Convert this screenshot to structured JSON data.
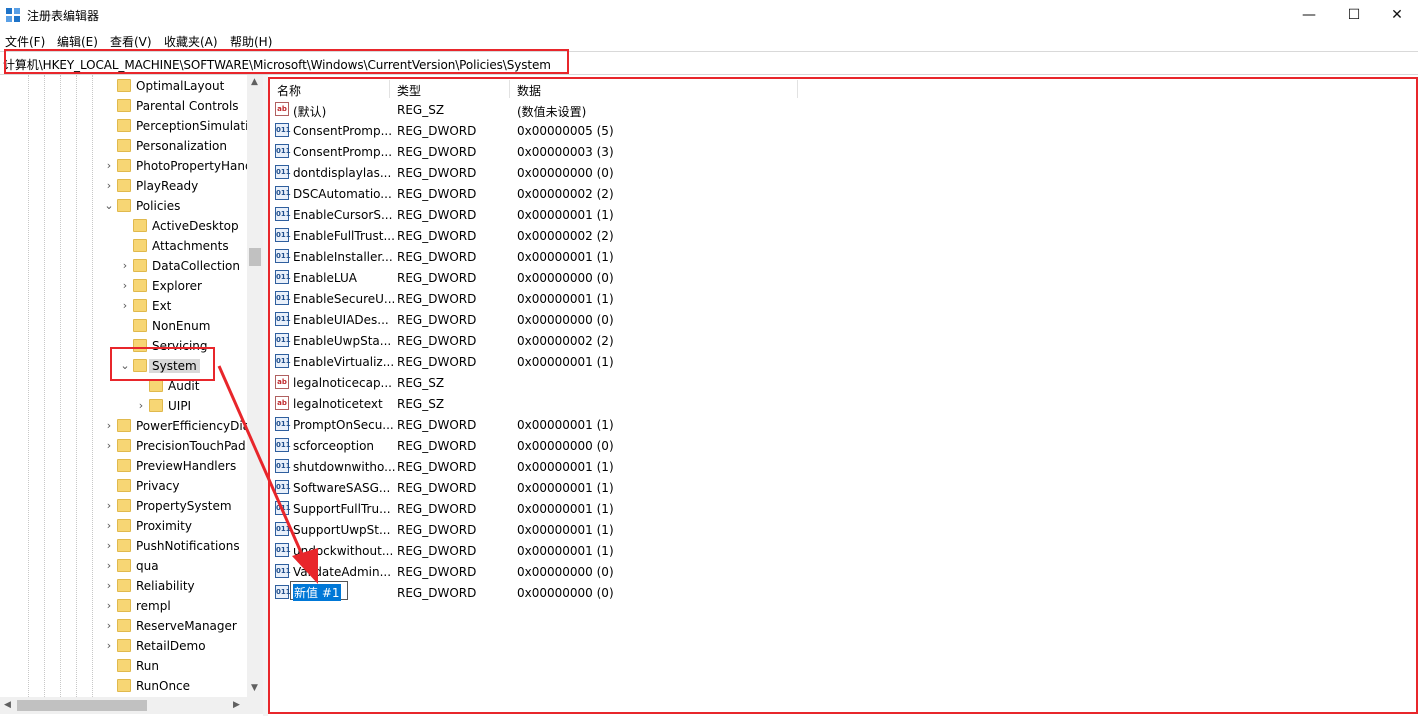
{
  "window": {
    "title": "注册表编辑器",
    "minimize_glyph": "—",
    "maximize_glyph": "☐",
    "close_glyph": "✕"
  },
  "menu": [
    "文件(F)",
    "编辑(E)",
    "查看(V)",
    "收藏夹(A)",
    "帮助(H)"
  ],
  "address": "计算机\\HKEY_LOCAL_MACHINE\\SOFTWARE\\Microsoft\\Windows\\CurrentVersion\\Policies\\System",
  "tree": [
    {
      "label": "OptimalLayout",
      "depth": 0,
      "chevron": ""
    },
    {
      "label": "Parental Controls",
      "depth": 0,
      "chevron": ""
    },
    {
      "label": "PerceptionSimulation",
      "depth": 0,
      "chevron": ""
    },
    {
      "label": "Personalization",
      "depth": 0,
      "chevron": ""
    },
    {
      "label": "PhotoPropertyHandler",
      "depth": 0,
      "chevron": "›"
    },
    {
      "label": "PlayReady",
      "depth": 0,
      "chevron": "›"
    },
    {
      "label": "Policies",
      "depth": 0,
      "chevron": "⌄"
    },
    {
      "label": "ActiveDesktop",
      "depth": 1,
      "chevron": ""
    },
    {
      "label": "Attachments",
      "depth": 1,
      "chevron": ""
    },
    {
      "label": "DataCollection",
      "depth": 1,
      "chevron": "›"
    },
    {
      "label": "Explorer",
      "depth": 1,
      "chevron": "›"
    },
    {
      "label": "Ext",
      "depth": 1,
      "chevron": "›"
    },
    {
      "label": "NonEnum",
      "depth": 1,
      "chevron": ""
    },
    {
      "label": "Servicing",
      "depth": 1,
      "chevron": ""
    },
    {
      "label": "System",
      "depth": 1,
      "chevron": "⌄",
      "selected": true
    },
    {
      "label": "Audit",
      "depth": 2,
      "chevron": ""
    },
    {
      "label": "UIPI",
      "depth": 2,
      "chevron": "›"
    },
    {
      "label": "PowerEfficiencyDiagnostics",
      "depth": 0,
      "chevron": "›"
    },
    {
      "label": "PrecisionTouchPad",
      "depth": 0,
      "chevron": "›"
    },
    {
      "label": "PreviewHandlers",
      "depth": 0,
      "chevron": ""
    },
    {
      "label": "Privacy",
      "depth": 0,
      "chevron": ""
    },
    {
      "label": "PropertySystem",
      "depth": 0,
      "chevron": "›"
    },
    {
      "label": "Proximity",
      "depth": 0,
      "chevron": "›"
    },
    {
      "label": "PushNotifications",
      "depth": 0,
      "chevron": "›"
    },
    {
      "label": "qua",
      "depth": 0,
      "chevron": "›"
    },
    {
      "label": "Reliability",
      "depth": 0,
      "chevron": "›"
    },
    {
      "label": "rempl",
      "depth": 0,
      "chevron": "›"
    },
    {
      "label": "ReserveManager",
      "depth": 0,
      "chevron": "›"
    },
    {
      "label": "RetailDemo",
      "depth": 0,
      "chevron": "›"
    },
    {
      "label": "Run",
      "depth": 0,
      "chevron": ""
    },
    {
      "label": "RunOnce",
      "depth": 0,
      "chevron": ""
    }
  ],
  "list": {
    "headers": [
      "名称",
      "类型",
      "数据"
    ],
    "rows": [
      {
        "icon": "sz",
        "name": "(默认)",
        "type": "REG_SZ",
        "data": "(数值未设置)"
      },
      {
        "icon": "dw",
        "name": "ConsentPromp...",
        "type": "REG_DWORD",
        "data": "0x00000005 (5)"
      },
      {
        "icon": "dw",
        "name": "ConsentPromp...",
        "type": "REG_DWORD",
        "data": "0x00000003 (3)"
      },
      {
        "icon": "dw",
        "name": "dontdisplaylas...",
        "type": "REG_DWORD",
        "data": "0x00000000 (0)"
      },
      {
        "icon": "dw",
        "name": "DSCAutomatio...",
        "type": "REG_DWORD",
        "data": "0x00000002 (2)"
      },
      {
        "icon": "dw",
        "name": "EnableCursorS...",
        "type": "REG_DWORD",
        "data": "0x00000001 (1)"
      },
      {
        "icon": "dw",
        "name": "EnableFullTrust...",
        "type": "REG_DWORD",
        "data": "0x00000002 (2)"
      },
      {
        "icon": "dw",
        "name": "EnableInstaller...",
        "type": "REG_DWORD",
        "data": "0x00000001 (1)"
      },
      {
        "icon": "dw",
        "name": "EnableLUA",
        "type": "REG_DWORD",
        "data": "0x00000000 (0)"
      },
      {
        "icon": "dw",
        "name": "EnableSecureU...",
        "type": "REG_DWORD",
        "data": "0x00000001 (1)"
      },
      {
        "icon": "dw",
        "name": "EnableUIADes...",
        "type": "REG_DWORD",
        "data": "0x00000000 (0)"
      },
      {
        "icon": "dw",
        "name": "EnableUwpSta...",
        "type": "REG_DWORD",
        "data": "0x00000002 (2)"
      },
      {
        "icon": "dw",
        "name": "EnableVirtualiz...",
        "type": "REG_DWORD",
        "data": "0x00000001 (1)"
      },
      {
        "icon": "sz",
        "name": "legalnoticecap...",
        "type": "REG_SZ",
        "data": ""
      },
      {
        "icon": "sz",
        "name": "legalnoticetext",
        "type": "REG_SZ",
        "data": ""
      },
      {
        "icon": "dw",
        "name": "PromptOnSecu...",
        "type": "REG_DWORD",
        "data": "0x00000001 (1)"
      },
      {
        "icon": "dw",
        "name": "scforceoption",
        "type": "REG_DWORD",
        "data": "0x00000000 (0)"
      },
      {
        "icon": "dw",
        "name": "shutdownwitho...",
        "type": "REG_DWORD",
        "data": "0x00000001 (1)"
      },
      {
        "icon": "dw",
        "name": "SoftwareSASG...",
        "type": "REG_DWORD",
        "data": "0x00000001 (1)"
      },
      {
        "icon": "dw",
        "name": "SupportFullTru...",
        "type": "REG_DWORD",
        "data": "0x00000001 (1)"
      },
      {
        "icon": "dw",
        "name": "SupportUwpSt...",
        "type": "REG_DWORD",
        "data": "0x00000001 (1)"
      },
      {
        "icon": "dw",
        "name": "undockwithout...",
        "type": "REG_DWORD",
        "data": "0x00000001 (1)"
      },
      {
        "icon": "dw",
        "name": "ValidateAdmin...",
        "type": "REG_DWORD",
        "data": "0x00000000 (0)"
      },
      {
        "icon": "dw",
        "name": "新值 #1",
        "type": "REG_DWORD",
        "data": "0x00000000 (0)",
        "editing": true
      }
    ]
  },
  "icon_glyphs": {
    "sz": "ab",
    "dw": "011"
  },
  "colors": {
    "highlight": "#e8262b",
    "selection": "#0078d7",
    "folder": "#f7d674"
  }
}
